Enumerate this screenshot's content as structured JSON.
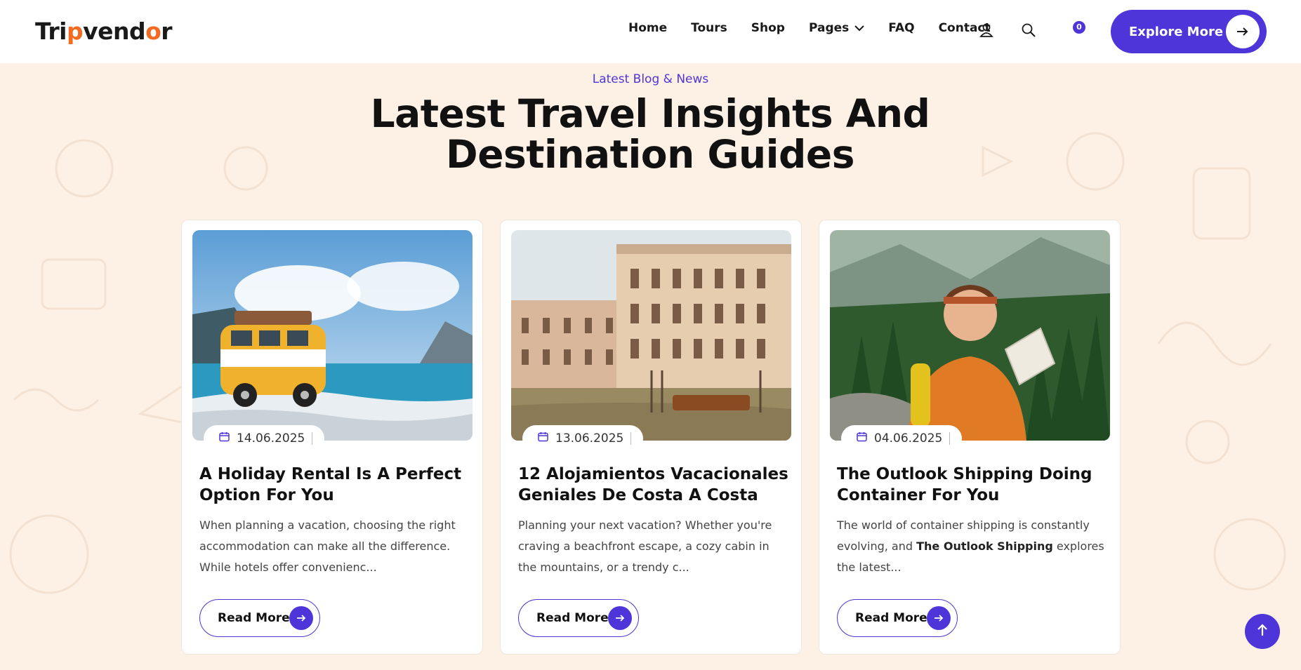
{
  "brand": {
    "logo_part1": "Tri",
    "logo_part2": "p",
    "logo_part3": "vend",
    "logo_part4": "o",
    "logo_part5": "r"
  },
  "nav": {
    "items": [
      {
        "label": "Home"
      },
      {
        "label": "Tours"
      },
      {
        "label": "Shop"
      },
      {
        "label": "Pages"
      },
      {
        "label": "FAQ"
      },
      {
        "label": "Contact"
      }
    ],
    "cart_count": "0",
    "cta_label": "Explore More"
  },
  "section": {
    "eyebrow": "Latest Blog & News",
    "title_line1": "Latest Travel Insights And",
    "title_line2": "Destination Guides"
  },
  "posts": [
    {
      "date": "14.06.2025",
      "title": "A Holiday Rental Is A Perfect Option For You",
      "excerpt": "When planning a vacation, choosing the right accommodation can make all the difference. While hotels offer convenienc...",
      "button": "Read More",
      "image": "yellow-van-by-lake"
    },
    {
      "date": "13.06.2025",
      "title": "12 Alojamientos Vacacionales Geniales De Costa A Costa",
      "excerpt": "Planning your next vacation? Whether you're craving a beachfront escape, a cozy cabin in the mountains, or a trendy c...",
      "button": "Read More",
      "image": "venice-palazzo-canal"
    },
    {
      "date": "04.06.2025",
      "title": "The Outlook Shipping Doing Container For You",
      "excerpt_before": "The world of container shipping is constantly evolving, and ",
      "excerpt_bold": "The Outlook Shipping",
      "excerpt_after": " explores the latest...",
      "button": "Read More",
      "image": "hiker-with-map"
    }
  ],
  "colors": {
    "accent": "#4e35d9",
    "brand_orange": "#f26b21",
    "page_bg": "#fdf1e6"
  },
  "icons": [
    "user-icon",
    "search-icon",
    "cart-icon",
    "arrow-right-icon",
    "calendar-icon",
    "arrow-up-icon",
    "chevron-down-icon"
  ]
}
